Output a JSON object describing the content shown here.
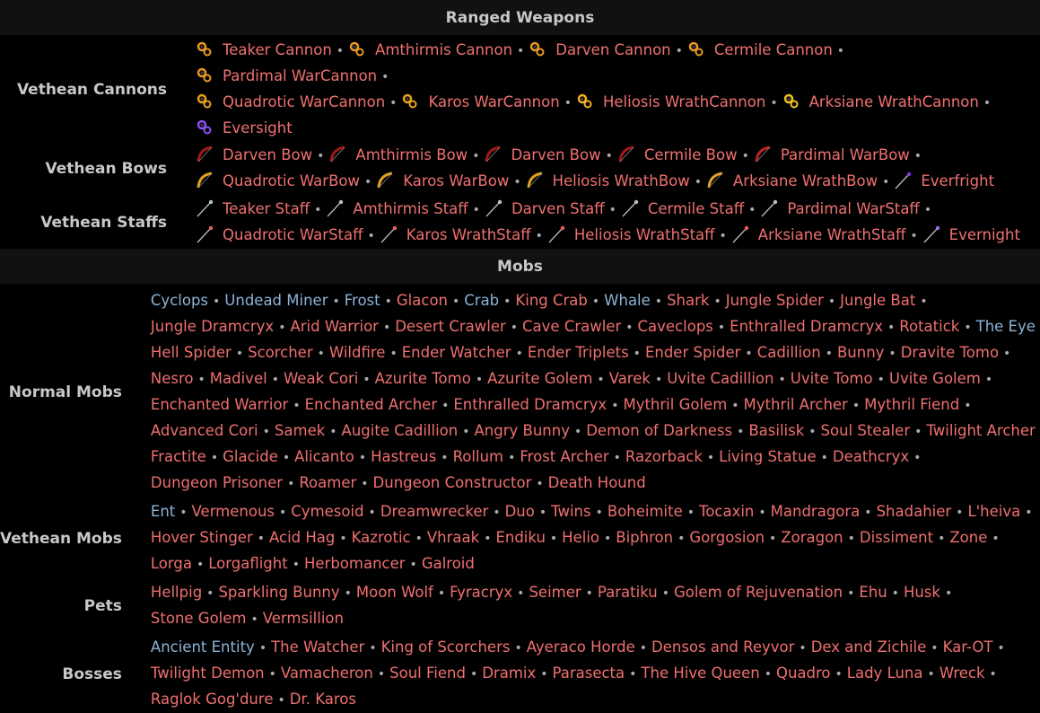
{
  "ranged": {
    "title": "Ranged Weapons",
    "groups": [
      {
        "label": "Vethean Cannons",
        "lines": [
          [
            {
              "name": "Teaker Cannon",
              "icon": "cannon-icon",
              "color": "#e89a20"
            },
            {
              "name": "Amthirmis Cannon",
              "icon": "cannon-icon",
              "color": "#e89a20"
            },
            {
              "name": "Darven Cannon",
              "icon": "cannon-icon",
              "color": "#e89a20"
            },
            {
              "name": "Cermile Cannon",
              "icon": "cannon-icon",
              "color": "#e89a20"
            },
            {
              "name": "Pardimal WarCannon",
              "icon": "cannon-icon",
              "color": "#e89a20"
            }
          ],
          [
            {
              "name": "Quadrotic WarCannon",
              "icon": "warcannon-icon",
              "color": "#e8a020"
            },
            {
              "name": "Karos WarCannon",
              "icon": "warcannon-icon",
              "color": "#e8a020"
            },
            {
              "name": "Heliosis WrathCannon",
              "icon": "wrathcannon-icon",
              "color": "#f0b020"
            },
            {
              "name": "Arksiane WrathCannon",
              "icon": "wrathcannon-icon",
              "color": "#f0c020"
            }
          ],
          [
            {
              "name": "Eversight",
              "icon": "eversight-icon",
              "color": "#8a50f0"
            }
          ]
        ]
      },
      {
        "label": "Vethean Bows",
        "lines": [
          [
            {
              "name": "Darven Bow",
              "icon": "bow-icon",
              "color": "#a01818"
            },
            {
              "name": "Amthirmis Bow",
              "icon": "bow-icon",
              "color": "#a01818"
            },
            {
              "name": "Darven Bow",
              "icon": "bow-icon",
              "color": "#a01818"
            },
            {
              "name": "Cermile Bow",
              "icon": "bow-icon",
              "color": "#a01818"
            },
            {
              "name": "Pardimal WarBow",
              "icon": "warbow-icon",
              "color": "#c02020"
            }
          ],
          [
            {
              "name": "Quadrotic WarBow",
              "icon": "warbow-icon",
              "color": "#e0a020"
            },
            {
              "name": "Karos WarBow",
              "icon": "warbow-icon",
              "color": "#e0a020"
            },
            {
              "name": "Heliosis WrathBow",
              "icon": "wrathbow-icon",
              "color": "#e0a020"
            },
            {
              "name": "Arksiane WrathBow",
              "icon": "wrathbow-icon",
              "color": "#e0a020"
            },
            {
              "name": "Everfright",
              "icon": "everfright-icon",
              "color": "#8030e0"
            }
          ]
        ]
      },
      {
        "label": "Vethean Staffs",
        "lines": [
          [
            {
              "name": "Teaker Staff",
              "icon": "staff-icon",
              "color": "#c0c0c0"
            },
            {
              "name": "Amthirmis Staff",
              "icon": "staff-icon",
              "color": "#c0c0c0"
            },
            {
              "name": "Darven Staff",
              "icon": "staff-icon",
              "color": "#c0c0c0"
            },
            {
              "name": "Cermile Staff",
              "icon": "staff-icon",
              "color": "#c0c0c0"
            },
            {
              "name": "Pardimal WarStaff",
              "icon": "staff-icon",
              "color": "#c0c0c0"
            }
          ],
          [
            {
              "name": "Quadrotic WarStaff",
              "icon": "warstaff-icon",
              "color": "#f06060"
            },
            {
              "name": "Karos WrathStaff",
              "icon": "warstaff-icon",
              "color": "#f06060"
            },
            {
              "name": "Heliosis WrathStaff",
              "icon": "wrathstaff-icon",
              "color": "#f06060"
            },
            {
              "name": "Arksiane WrathStaff",
              "icon": "wrathstaff-icon",
              "color": "#f06060"
            },
            {
              "name": "Evernight",
              "icon": "evernight-icon",
              "color": "#9a70e0"
            }
          ]
        ]
      }
    ]
  },
  "mobs": {
    "title": "Mobs",
    "groups": [
      {
        "label": "Normal Mobs",
        "lines": [
          [
            {
              "name": "Cyclops",
              "blue": true
            },
            {
              "name": "Undead Miner",
              "blue": true
            },
            {
              "name": "Frost",
              "blue": true
            },
            {
              "name": "Glacon"
            },
            {
              "name": "Crab",
              "blue": true
            },
            {
              "name": "King Crab"
            },
            {
              "name": "Whale",
              "blue": true
            },
            {
              "name": "Shark"
            },
            {
              "name": "Jungle Spider"
            },
            {
              "name": "Jungle Bat"
            }
          ],
          [
            {
              "name": "Jungle Dramcryx"
            },
            {
              "name": "Arid Warrior"
            },
            {
              "name": "Desert Crawler"
            },
            {
              "name": "Cave Crawler"
            },
            {
              "name": "Caveclops"
            },
            {
              "name": "Enthralled Dramcryx"
            },
            {
              "name": "Rotatick"
            },
            {
              "name": "The Eye",
              "blue": true
            }
          ],
          [
            {
              "name": "Hell Spider"
            },
            {
              "name": "Scorcher"
            },
            {
              "name": "Wildfire"
            },
            {
              "name": "Ender Watcher"
            },
            {
              "name": "Ender Triplets"
            },
            {
              "name": "Ender Spider"
            },
            {
              "name": "Cadillion"
            },
            {
              "name": "Bunny"
            },
            {
              "name": "Dravite Tomo"
            }
          ],
          [
            {
              "name": "Nesro"
            },
            {
              "name": "Madivel"
            },
            {
              "name": "Weak Cori"
            },
            {
              "name": "Azurite Tomo"
            },
            {
              "name": "Azurite Golem"
            },
            {
              "name": "Varek"
            },
            {
              "name": "Uvite Cadillion"
            },
            {
              "name": "Uvite Tomo"
            },
            {
              "name": "Uvite Golem"
            }
          ],
          [
            {
              "name": "Enchanted Warrior"
            },
            {
              "name": "Enchanted Archer"
            },
            {
              "name": "Enthralled Dramcryx"
            },
            {
              "name": "Mythril Golem"
            },
            {
              "name": "Mythril Archer"
            },
            {
              "name": "Mythril Fiend"
            }
          ],
          [
            {
              "name": "Advanced Cori"
            },
            {
              "name": "Samek"
            },
            {
              "name": "Augite Cadillion"
            },
            {
              "name": "Angry Bunny"
            },
            {
              "name": "Demon of Darkness"
            },
            {
              "name": "Basilisk"
            },
            {
              "name": "Soul Stealer"
            },
            {
              "name": "Twilight Archer"
            }
          ],
          [
            {
              "name": "Fractite"
            },
            {
              "name": "Glacide"
            },
            {
              "name": "Alicanto"
            },
            {
              "name": "Hastreus"
            },
            {
              "name": "Rollum"
            },
            {
              "name": "Frost Archer"
            },
            {
              "name": "Razorback"
            },
            {
              "name": "Living Statue"
            },
            {
              "name": "Deathcryx"
            }
          ],
          [
            {
              "name": "Dungeon Prisoner"
            },
            {
              "name": "Roamer"
            },
            {
              "name": "Dungeon Constructor"
            },
            {
              "name": "Death Hound"
            }
          ]
        ]
      },
      {
        "label": "Vethean Mobs",
        "lines": [
          [
            {
              "name": "Ent",
              "blue": true
            },
            {
              "name": "Vermenous"
            },
            {
              "name": "Cymesoid"
            },
            {
              "name": "Dreamwrecker"
            },
            {
              "name": "Duo"
            },
            {
              "name": "Twins"
            },
            {
              "name": "Boheimite"
            },
            {
              "name": "Tocaxin"
            },
            {
              "name": "Mandragora"
            },
            {
              "name": "Shadahier"
            },
            {
              "name": "L'heiva"
            }
          ],
          [
            {
              "name": "Hover Stinger"
            },
            {
              "name": "Acid Hag"
            },
            {
              "name": "Kazrotic"
            },
            {
              "name": "Vhraak"
            },
            {
              "name": "Endiku"
            },
            {
              "name": "Helio"
            },
            {
              "name": "Biphron"
            },
            {
              "name": "Gorgosion"
            },
            {
              "name": "Zoragon"
            },
            {
              "name": "Dissiment"
            },
            {
              "name": "Zone"
            }
          ],
          [
            {
              "name": "Lorga"
            },
            {
              "name": "Lorgaflight"
            },
            {
              "name": "Herbomancer"
            },
            {
              "name": "Galroid"
            }
          ]
        ]
      },
      {
        "label": "Pets",
        "lines": [
          [
            {
              "name": "Hellpig"
            },
            {
              "name": "Sparkling Bunny"
            },
            {
              "name": "Moon Wolf"
            },
            {
              "name": "Fyracryx"
            },
            {
              "name": "Seimer"
            },
            {
              "name": "Paratiku"
            },
            {
              "name": "Golem of Rejuvenation"
            },
            {
              "name": "Ehu"
            },
            {
              "name": "Husk"
            }
          ],
          [
            {
              "name": "Stone Golem"
            },
            {
              "name": "Vermsillion"
            }
          ]
        ]
      },
      {
        "label": "Bosses",
        "lines": [
          [
            {
              "name": "Ancient Entity",
              "blue": true
            },
            {
              "name": "The Watcher"
            },
            {
              "name": "King of Scorchers"
            },
            {
              "name": "Ayeraco Horde"
            },
            {
              "name": "Densos and Reyvor"
            },
            {
              "name": "Dex and Zichile"
            },
            {
              "name": "Kar-OT"
            }
          ],
          [
            {
              "name": "Twilight Demon"
            },
            {
              "name": "Vamacheron"
            },
            {
              "name": "Soul Fiend"
            },
            {
              "name": "Dramix"
            },
            {
              "name": "Parasecta"
            },
            {
              "name": "The Hive Queen"
            },
            {
              "name": "Quadro"
            },
            {
              "name": "Lady Luna"
            },
            {
              "name": "Wreck"
            }
          ],
          [
            {
              "name": "Raglok Gog'dure"
            },
            {
              "name": "Dr. Karos"
            }
          ]
        ]
      }
    ]
  },
  "separator": "•"
}
